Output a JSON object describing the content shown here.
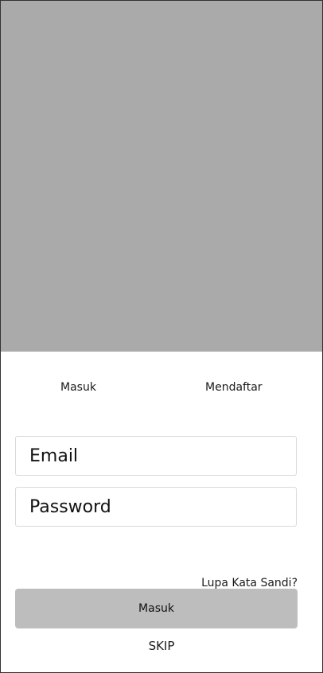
{
  "tabs": {
    "login_label": "Masuk",
    "register_label": "Mendaftar"
  },
  "form": {
    "email_placeholder": "Email",
    "password_placeholder": "Password",
    "forgot_label": "Lupa Kata Sandi?",
    "submit_label": "Masuk"
  },
  "skip_label": "SKIP",
  "colors": {
    "hero_placeholder": "#aaaaaa",
    "button_bg": "#bdbdbd",
    "field_border": "#d9d9d9"
  }
}
